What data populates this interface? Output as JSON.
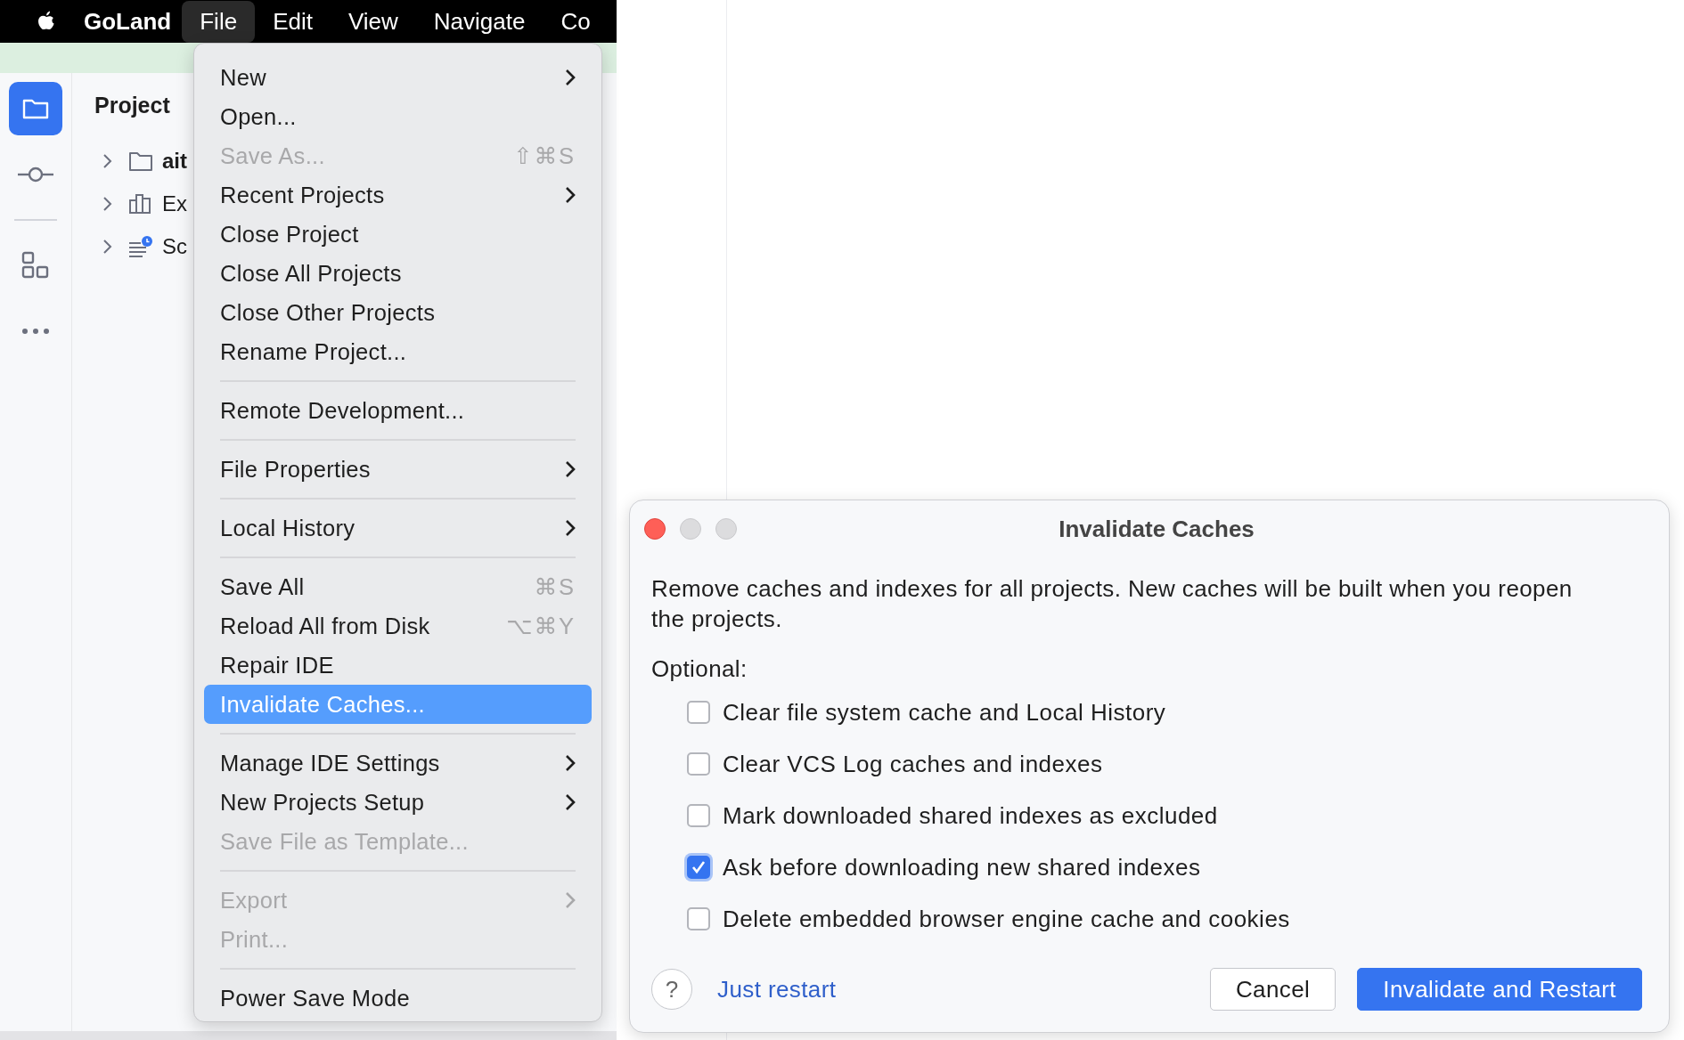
{
  "menu_bar": {
    "app_name": "GoLand",
    "items": [
      {
        "label": "File",
        "selected": true
      },
      {
        "label": "Edit",
        "selected": false
      },
      {
        "label": "View",
        "selected": false
      },
      {
        "label": "Navigate",
        "selected": false
      },
      {
        "label": "Co",
        "selected": false
      }
    ]
  },
  "project_panel": {
    "title": "Project",
    "tree": [
      {
        "label": "ait",
        "kind": "folder",
        "expanded": false
      },
      {
        "label": "Ex",
        "kind": "library",
        "expanded": false
      },
      {
        "label": "Sc",
        "kind": "scratches",
        "expanded": false
      }
    ]
  },
  "sidebar": {
    "items": [
      {
        "kind": "folder",
        "selected": true
      },
      {
        "kind": "commit",
        "selected": false
      },
      {
        "kind": "divider",
        "selected": false
      },
      {
        "kind": "structure",
        "selected": false
      },
      {
        "kind": "more",
        "selected": false
      }
    ]
  },
  "file_menu": {
    "items": [
      {
        "kind": "item",
        "label": "New",
        "submenu": true,
        "disabled": false,
        "selected": false
      },
      {
        "kind": "item",
        "label": "Open...",
        "submenu": false,
        "disabled": false,
        "selected": false
      },
      {
        "kind": "item",
        "label": "Save As...",
        "shortcut": "⇧⌘S",
        "submenu": false,
        "disabled": true,
        "selected": false
      },
      {
        "kind": "item",
        "label": "Recent Projects",
        "submenu": true,
        "disabled": false,
        "selected": false
      },
      {
        "kind": "item",
        "label": "Close Project",
        "submenu": false,
        "disabled": false,
        "selected": false
      },
      {
        "kind": "item",
        "label": "Close All Projects",
        "submenu": false,
        "disabled": false,
        "selected": false
      },
      {
        "kind": "item",
        "label": "Close Other Projects",
        "submenu": false,
        "disabled": false,
        "selected": false
      },
      {
        "kind": "item",
        "label": "Rename Project...",
        "submenu": false,
        "disabled": false,
        "selected": false
      },
      {
        "kind": "separator"
      },
      {
        "kind": "item",
        "label": "Remote Development...",
        "submenu": false,
        "disabled": false,
        "selected": false
      },
      {
        "kind": "separator"
      },
      {
        "kind": "item",
        "label": "File Properties",
        "submenu": true,
        "disabled": false,
        "selected": false
      },
      {
        "kind": "separator"
      },
      {
        "kind": "item",
        "label": "Local History",
        "submenu": true,
        "disabled": false,
        "selected": false
      },
      {
        "kind": "separator"
      },
      {
        "kind": "item",
        "label": "Save All",
        "shortcut": "⌘S",
        "submenu": false,
        "disabled": false,
        "selected": false
      },
      {
        "kind": "item",
        "label": "Reload All from Disk",
        "shortcut": "⌥⌘Y",
        "submenu": false,
        "disabled": false,
        "selected": false
      },
      {
        "kind": "item",
        "label": "Repair IDE",
        "submenu": false,
        "disabled": false,
        "selected": false
      },
      {
        "kind": "item",
        "label": "Invalidate Caches...",
        "submenu": false,
        "disabled": false,
        "selected": true
      },
      {
        "kind": "separator"
      },
      {
        "kind": "item",
        "label": "Manage IDE Settings",
        "submenu": true,
        "disabled": false,
        "selected": false
      },
      {
        "kind": "item",
        "label": "New Projects Setup",
        "submenu": true,
        "disabled": false,
        "selected": false
      },
      {
        "kind": "item",
        "label": "Save File as Template...",
        "submenu": false,
        "disabled": true,
        "selected": false
      },
      {
        "kind": "separator"
      },
      {
        "kind": "item",
        "label": "Export",
        "submenu": true,
        "disabled": true,
        "selected": false
      },
      {
        "kind": "item",
        "label": "Print...",
        "submenu": false,
        "disabled": true,
        "selected": false
      },
      {
        "kind": "separator"
      },
      {
        "kind": "item",
        "label": "Power Save Mode",
        "submenu": false,
        "disabled": false,
        "selected": false
      }
    ]
  },
  "dialog": {
    "title": "Invalidate Caches",
    "description": "Remove caches and indexes for all projects. New caches will be built when you reopen the projects.",
    "options_label": "Optional:",
    "options": [
      {
        "label": "Clear file system cache and Local History",
        "checked": false
      },
      {
        "label": "Clear VCS Log caches and indexes",
        "checked": false
      },
      {
        "label": "Mark downloaded shared indexes as excluded",
        "checked": false
      },
      {
        "label": "Ask before downloading new shared indexes",
        "checked": true
      },
      {
        "label": "Delete embedded browser engine cache and cookies",
        "checked": false
      }
    ],
    "help": "?",
    "link": "Just restart",
    "buttons": [
      {
        "label": "Cancel",
        "kind": "default"
      },
      {
        "label": "Invalidate and Restart",
        "kind": "primary"
      }
    ]
  }
}
